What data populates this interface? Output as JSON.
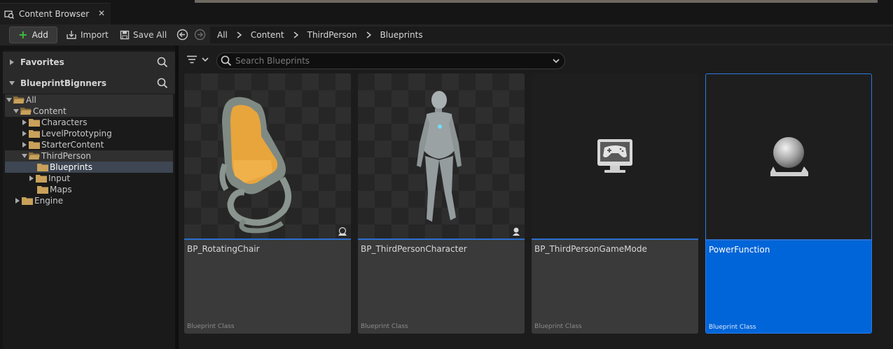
{
  "tab": {
    "title": "Content Browser",
    "close": "✕",
    "icon": "content-browser-icon"
  },
  "toolbar": {
    "add_label": "Add",
    "import_label": "Import",
    "save_all_label": "Save All"
  },
  "breadcrumb": [
    "All",
    "Content",
    "ThirdPerson",
    "Blueprints"
  ],
  "favorites": {
    "title": "Favorites"
  },
  "project": {
    "title": "BlueprintBignners"
  },
  "tree": [
    {
      "label": "All",
      "expanded": true,
      "open": true
    },
    {
      "label": "Content",
      "expanded": true,
      "open": true
    },
    {
      "label": "Characters",
      "expanded": false
    },
    {
      "label": "LevelPrototyping",
      "expanded": false
    },
    {
      "label": "StarterContent",
      "expanded": false
    },
    {
      "label": "ThirdPerson",
      "expanded": true,
      "open": true
    },
    {
      "label": "Blueprints",
      "selected": true
    },
    {
      "label": "Input",
      "expanded": false
    },
    {
      "label": "Maps"
    },
    {
      "label": "Engine",
      "expanded": false
    }
  ],
  "search": {
    "placeholder": "Search Blueprints",
    "value": ""
  },
  "assets": [
    {
      "name": "BP_RotatingChair",
      "type": "Blueprint Class",
      "thumbnail": "chair-thumbnail",
      "badge": "actor-icon"
    },
    {
      "name": "BP_ThirdPersonCharacter",
      "type": "Blueprint Class",
      "thumbnail": "mannequin-thumbnail",
      "badge": "character-icon"
    },
    {
      "name": "BP_ThirdPersonGameMode",
      "type": "Blueprint Class",
      "thumbnail": "game-mode-icon"
    },
    {
      "name": "PowerFunction",
      "type": "Blueprint Class",
      "thumbnail": "actor-sphere-icon",
      "selected": true
    }
  ],
  "colors": {
    "selection": "#0065d8",
    "accent_bar": "#2b6fd0",
    "folder": "#c9a15a",
    "add_plus": "#3fbf3f"
  }
}
